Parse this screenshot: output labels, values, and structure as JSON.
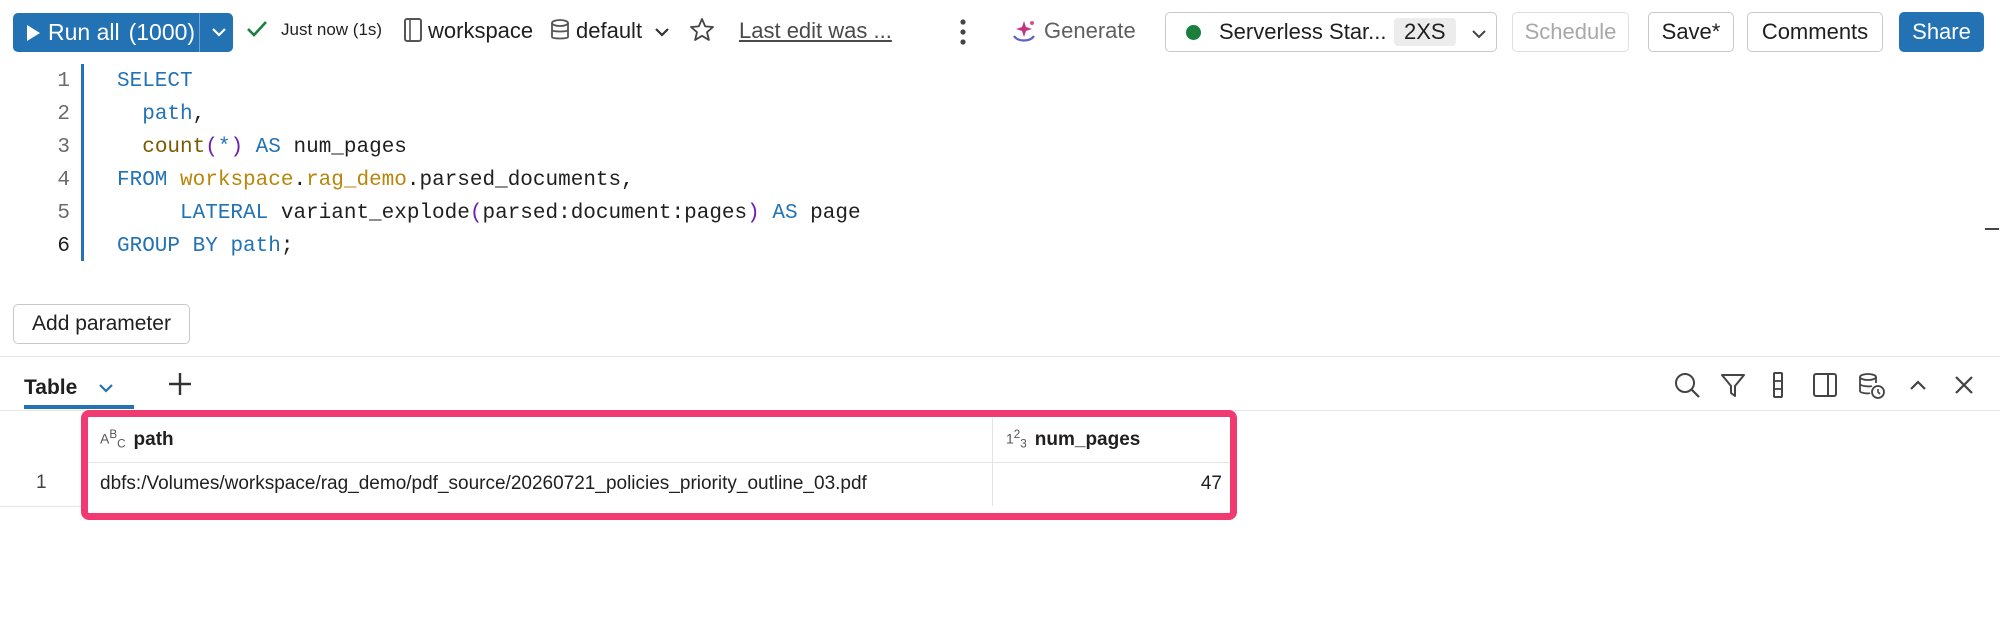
{
  "toolbar": {
    "run_all_label": "Run all",
    "run_all_count": "(1000)",
    "status_text": "Just now (1s)",
    "catalog": "workspace",
    "schema": "default",
    "last_edit": "Last edit was ...",
    "generate_label": "Generate",
    "compute_name": "Serverless Star...",
    "compute_size": "2XS",
    "schedule_label": "Schedule",
    "save_label": "Save*",
    "comments_label": "Comments",
    "share_label": "Share",
    "colors": {
      "primary": "#2272b4",
      "compute_status": "#1b7f3b"
    }
  },
  "editor": {
    "line_numbers": [
      "1",
      "2",
      "3",
      "4",
      "5",
      "6"
    ],
    "lines": [
      [
        {
          "t": "SELECT",
          "c": "kw"
        }
      ],
      [
        {
          "t": "  "
        },
        {
          "t": "path",
          "c": "kw"
        },
        {
          "t": ","
        }
      ],
      [
        {
          "t": "  "
        },
        {
          "t": "count",
          "c": "fn"
        },
        {
          "t": "(",
          "c": "paren"
        },
        {
          "t": "*",
          "c": "kw"
        },
        {
          "t": ")",
          "c": "paren"
        },
        {
          "t": " "
        },
        {
          "t": "AS",
          "c": "kw"
        },
        {
          "t": " num_pages"
        }
      ],
      [
        {
          "t": "FROM",
          "c": "kw"
        },
        {
          "t": " "
        },
        {
          "t": "workspace",
          "c": "schema"
        },
        {
          "t": "."
        },
        {
          "t": "rag_demo",
          "c": "schema"
        },
        {
          "t": ".parsed_documents,"
        }
      ],
      [
        {
          "t": "     "
        },
        {
          "t": "LATERAL",
          "c": "kw"
        },
        {
          "t": " variant_explode"
        },
        {
          "t": "(",
          "c": "paren"
        },
        {
          "t": "parsed:document:pages"
        },
        {
          "t": ")",
          "c": "paren"
        },
        {
          "t": " "
        },
        {
          "t": "AS",
          "c": "kw"
        },
        {
          "t": " page"
        }
      ],
      [
        {
          "t": "GROUP BY",
          "c": "kw"
        },
        {
          "t": " "
        },
        {
          "t": "path",
          "c": "kw"
        },
        {
          "t": ";"
        }
      ]
    ]
  },
  "add_parameter_label": "Add parameter",
  "results": {
    "tab_label": "Table",
    "columns": [
      {
        "type_icon": "ABC",
        "name": "path"
      },
      {
        "type_icon": "123",
        "name": "num_pages"
      }
    ],
    "rows": [
      {
        "row_number": "1",
        "path": "dbfs:/Volumes/workspace/rag_demo/pdf_source/20260721_policies_priority_outline_03.pdf",
        "num_pages": "47"
      }
    ],
    "highlight_color": "#f23a72"
  }
}
